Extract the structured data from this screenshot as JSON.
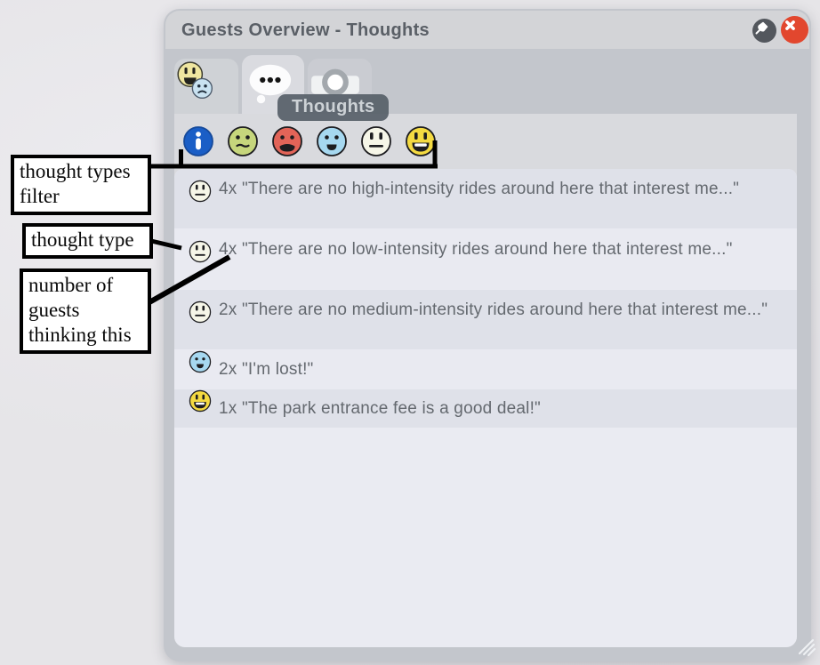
{
  "window": {
    "title": "Guests Overview - Thoughts",
    "pin_icon": "pushpin-icon",
    "close_icon": "close-x-icon"
  },
  "tabs": [
    {
      "id": "guests",
      "icon": "guests-faces-icon",
      "active": false
    },
    {
      "id": "thoughts",
      "icon": "speech-bubble-icon",
      "active": true,
      "tooltip": "Thoughts"
    },
    {
      "id": "camera",
      "icon": "camera-icon",
      "active": false
    }
  ],
  "tooltip": {
    "text": "Thoughts"
  },
  "filters": [
    {
      "icon": "info-icon"
    },
    {
      "icon": "sick-face-icon"
    },
    {
      "icon": "angry-face-icon"
    },
    {
      "icon": "sad-face-icon"
    },
    {
      "icon": "neutral-face-icon"
    },
    {
      "icon": "happy-face-icon"
    }
  ],
  "thoughts": {
    "items": [
      {
        "icon": "neutral-face-icon",
        "count": "4x",
        "text": "\"There are no high-intensity rides around here that interest me...\""
      },
      {
        "icon": "neutral-face-icon",
        "count": "4x",
        "text": "\"There are no low-intensity rides around here that interest me...\""
      },
      {
        "icon": "neutral-face-icon",
        "count": "2x",
        "text": "\"There are no medium-intensity rides around here that interest me...\""
      },
      {
        "icon": "sad-face-icon",
        "count": "2x",
        "text": "\"I'm lost!\""
      },
      {
        "icon": "happy-face-icon",
        "count": "1x",
        "text": "\"The park entrance fee is a good deal!\""
      }
    ]
  },
  "annotations": [
    {
      "text": "thought types filter"
    },
    {
      "text": "thought type"
    },
    {
      "text": "number of guests thinking this"
    }
  ],
  "colors": {
    "close_red": "#e2472e",
    "pin_gray": "#53575d",
    "info_blue": "#1a5ec6",
    "sick_green": "#c6d67c",
    "angry_red": "#e26458",
    "sad_blue": "#a6d8f0",
    "neutral_cream": "#f6f6e8",
    "happy_yellow": "#f4da41",
    "tooltip_bg": "#576068",
    "row_dark": "#dfe1e9",
    "row_light": "#e9eaf1"
  }
}
